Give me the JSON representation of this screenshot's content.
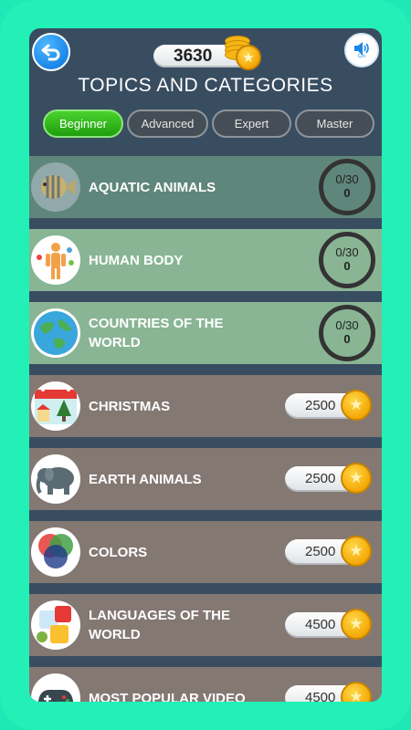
{
  "header": {
    "score": "3630",
    "title": "TOPICS AND CATEGORIES",
    "sound_state": "On"
  },
  "tabs": [
    {
      "label": "Beginner",
      "active": true
    },
    {
      "label": "Advanced",
      "active": false
    },
    {
      "label": "Expert",
      "active": false
    },
    {
      "label": "Master",
      "active": false
    }
  ],
  "categories": [
    {
      "label": "AQUATIC ANIMALS",
      "icon": "fish-icon",
      "progress": "0/30",
      "score": "0"
    },
    {
      "label": "HUMAN BODY",
      "icon": "human-body-icon",
      "progress": "0/30",
      "score": "0"
    },
    {
      "label": "COUNTRIES OF THE WORLD",
      "icon": "globe-icon",
      "progress": "0/30",
      "score": "0"
    },
    {
      "label": "CHRISTMAS",
      "icon": "christmas-calendar-icon",
      "price": "2500"
    },
    {
      "label": "EARTH ANIMALS",
      "icon": "elephant-icon",
      "price": "2500"
    },
    {
      "label": "COLORS",
      "icon": "color-circles-icon",
      "price": "2500"
    },
    {
      "label": "LANGUAGES OF THE WORLD",
      "icon": "translate-icon",
      "price": "4500"
    },
    {
      "label": "MOST POPULAR VIDEO",
      "icon": "gamepad-icon",
      "price": "4500"
    }
  ],
  "colors": {
    "background": "#22f0b6",
    "panel": "#394d61",
    "unlocked_row": "#89b595",
    "locked_row": "#847873",
    "active_tab": "#2fb81a",
    "coin": "#f5b614"
  }
}
